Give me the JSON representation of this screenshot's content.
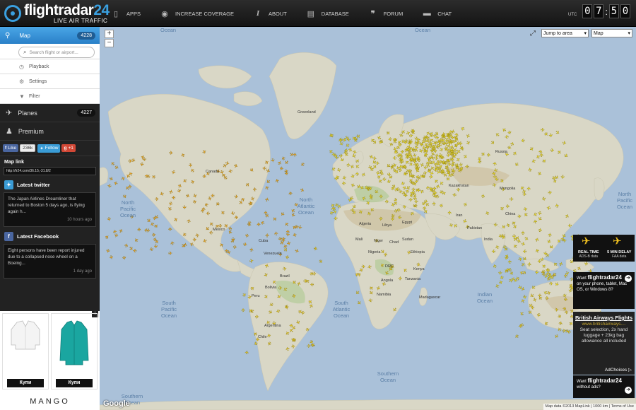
{
  "header": {
    "logo_main": "flightradar",
    "logo_num": "24",
    "logo_sub": "LIVE AIR TRAFFIC",
    "nav": [
      {
        "label": "APPS",
        "icon": "mobile-icon"
      },
      {
        "label": "INCREASE COVERAGE",
        "icon": "eye-icon"
      },
      {
        "label": "ABOUT",
        "icon": "info-icon"
      },
      {
        "label": "DATABASE",
        "icon": "database-icon"
      },
      {
        "label": "FORUM",
        "icon": "quote-icon"
      },
      {
        "label": "CHAT",
        "icon": "chat-icon"
      }
    ],
    "utc_label": "UTC",
    "clock": [
      "0",
      "7",
      "5",
      "0"
    ]
  },
  "sidebar": {
    "map_label": "Map",
    "map_count": "4228",
    "search_placeholder": "Search flight or airport...",
    "submenu": [
      {
        "label": "Playback",
        "icon": "clock-icon"
      },
      {
        "label": "Settings",
        "icon": "gear-icon"
      },
      {
        "label": "Filter",
        "icon": "filter-icon"
      }
    ],
    "planes_label": "Planes",
    "planes_count": "4227",
    "premium_label": "Premium",
    "social": {
      "like": "Like",
      "like_count": "236k",
      "follow": "Follow",
      "plus": "+1"
    },
    "maplink_title": "Map link",
    "maplink_url": "http://fr24.com/36.15,-31.8/2",
    "twitter_title": "Latest twitter",
    "twitter_text": "The Japan Airlines Dreamliner that returned to Boston 5 days ago, is flying again h...",
    "twitter_time": "10 hours ago",
    "facebook_title": "Latest Facebook",
    "facebook_text": "Eight persons have been report injured due to a collapsed nose wheel on a Boeing...",
    "facebook_time": "1 day ago"
  },
  "left_ad": {
    "buy_label": "Купи",
    "brand": "MANGO",
    "info": "i"
  },
  "map": {
    "jump_label": "Jump to area",
    "type_label": "Map",
    "zoom_in": "+",
    "zoom_out": "−",
    "oceans": [
      {
        "text": "Ocean"
      },
      {
        "text": "Ocean"
      },
      {
        "text": "North Pacific Ocean"
      },
      {
        "text": "North Atlantic Ocean"
      },
      {
        "text": "South Pacific Ocean"
      },
      {
        "text": "South Atlantic Ocean"
      },
      {
        "text": "Indian Ocean"
      },
      {
        "text": "Southern Ocean"
      },
      {
        "text": "Southern Ocean"
      },
      {
        "text": "North Pacific Ocean"
      }
    ],
    "places": [
      "Greenland",
      "Canada",
      "Mexico",
      "Venezuela",
      "Brazil",
      "Bolivia",
      "Argentina",
      "Algeria",
      "Libya",
      "Egypt",
      "Mali",
      "Niger",
      "Chad",
      "Sudan",
      "Nigeria",
      "Ethiopia",
      "DRC",
      "Kenya",
      "Tanzania",
      "Angola",
      "Namibia",
      "Madagascar",
      "Kazakhstan",
      "Mongolia",
      "China",
      "India",
      "Iran",
      "Pakistan",
      "Russia",
      "Cuba",
      "Peru",
      "Chile"
    ],
    "attribution": "Map data ©2013 MapLink",
    "scale": "1000 km",
    "terms": "Terms of Use",
    "google": "Google",
    "plane_regions": [
      {
        "name": "north-america",
        "density": "high",
        "color": "#f0a020"
      },
      {
        "name": "europe-russia",
        "density": "very-high",
        "color": "#f0e020"
      },
      {
        "name": "asia",
        "density": "high",
        "color": "#f0e020"
      },
      {
        "name": "south-america",
        "density": "medium",
        "color": "#f0d020"
      },
      {
        "name": "africa",
        "density": "low",
        "color": "#f0d020"
      },
      {
        "name": "australia",
        "density": "medium",
        "color": "#f0d020"
      }
    ]
  },
  "right_ads": {
    "realtime_title": "REAL TIME",
    "realtime_sub": "ADS-B data",
    "delay_title": "5 MIN DELAY",
    "delay_sub": "FAA data",
    "app_want": "Want",
    "app_brand": "flightradar24",
    "app_text": "on your phone, tablet, Mac OS, or Windows 8?",
    "ba_title": "British Airways Flights",
    "ba_url": "www.britishairways....",
    "ba_text": "Seat selection, 2x hand luggage + 23kg bag allowance all included",
    "adchoices": "AdChoices",
    "noads_want": "Want",
    "noads_brand": "flightradar24",
    "noads_text": "without ads?"
  },
  "colors": {
    "accent": "#3aa0e0",
    "ocean": "#aac1d9",
    "land": "#d8d6c4",
    "plane_yellow": "#f0e020",
    "plane_orange": "#f0a020"
  }
}
